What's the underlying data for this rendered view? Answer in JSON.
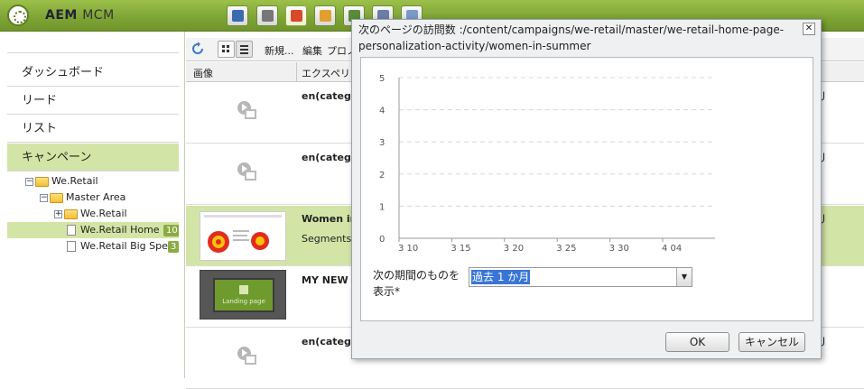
{
  "app": {
    "title_bold": "AEM",
    "title_light": "MCM"
  },
  "top_tools": [
    {
      "icon": "globe-icon",
      "color": "#3a6ab0"
    },
    {
      "icon": "camera-icon",
      "color": "#777"
    },
    {
      "icon": "megaphone-icon",
      "color": "#d84a2a"
    },
    {
      "icon": "mail-icon",
      "color": "#e0a030"
    },
    {
      "icon": "people-icon",
      "color": "#5a8a3a"
    },
    {
      "icon": "tools-icon",
      "color": "#6a7fa8"
    },
    {
      "icon": "tag-icon",
      "color": "#7a9ac8"
    }
  ],
  "sidebar": {
    "items": [
      {
        "label": "ダッシュボード"
      },
      {
        "label": "リード"
      },
      {
        "label": "リスト"
      },
      {
        "label": "キャンペーン"
      }
    ],
    "tree": [
      {
        "label": "We.Retail"
      },
      {
        "label": "Master Area"
      },
      {
        "label": "We.Retail"
      },
      {
        "label": "We.Retail Home Pa",
        "badge": "10"
      },
      {
        "label": "We.Retail Big Spend",
        "badge": "3"
      }
    ]
  },
  "toolbar": {
    "new_label": "新規...",
    "edit_label": "編集",
    "promote_label": "プロノ"
  },
  "table": {
    "headers": [
      "画像",
      "エクスペリ"
    ],
    "rows": [
      {
        "title": "en(catego",
        "sub": ""
      },
      {
        "title": "en(catego",
        "sub": ""
      },
      {
        "title": "Women in",
        "sub": "Segments: ;"
      },
      {
        "title": "MY NEW LA",
        "sub": ""
      },
      {
        "title": "en(catego",
        "sub": ""
      }
    ],
    "landing_label": "Landing page",
    "right_glyph": "ل"
  },
  "dialog": {
    "title": "次のページの訪問数 :/content/campaigns/we-retail/master/we-retail-home-page-personalization-activity/women-in-summer",
    "period_label": "次の期間のものを表示*",
    "period_value": "過去 1 か月",
    "ok_label": "OK",
    "cancel_label": "キャンセル"
  },
  "chart_data": {
    "type": "line",
    "x_ticks": [
      "3 10",
      "3 15",
      "3 20",
      "3 25",
      "3 30",
      "4 04"
    ],
    "y_ticks": [
      "0",
      "1",
      "2",
      "3",
      "4",
      "5"
    ],
    "ylim": [
      0,
      5
    ],
    "series": [],
    "grid": true,
    "title": "",
    "xlabel": "",
    "ylabel": ""
  }
}
